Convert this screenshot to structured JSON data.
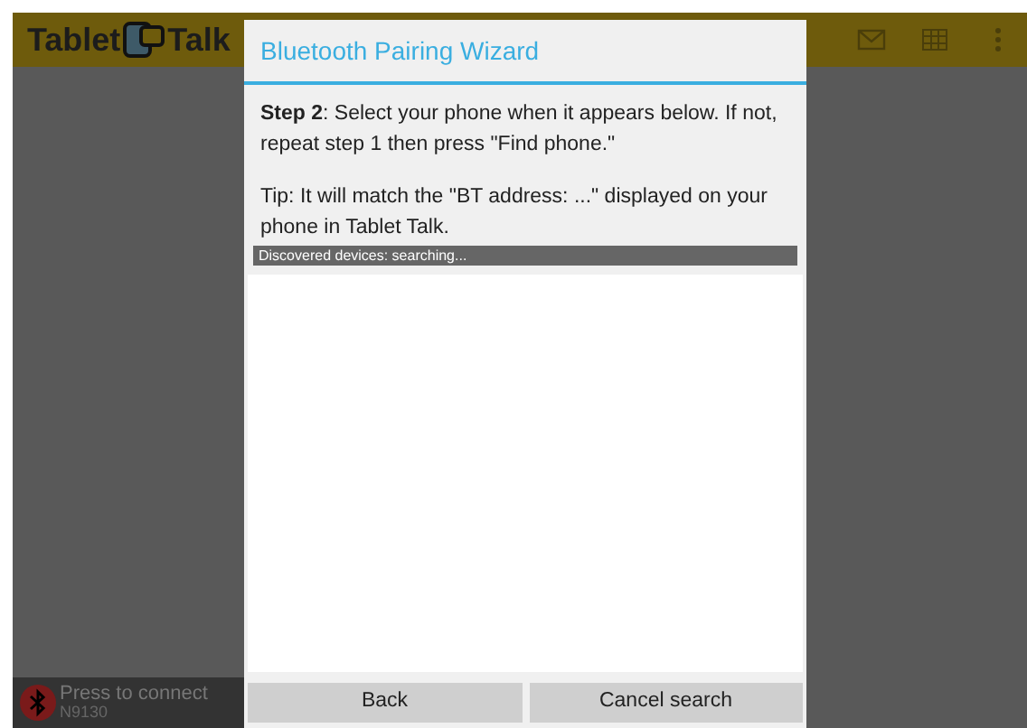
{
  "app_bar": {
    "logo_left": "Tablet",
    "logo_right": "Talk"
  },
  "dialog": {
    "title": "Bluetooth Pairing Wizard",
    "instructions": "**Step 2**: Select your phone when it appears below. If not, repeat step 1 then press \"Find phone.\"",
    "tip": "Tip: It will match the \"BT address: ...\" displayed on your phone in Tablet Talk.",
    "status": "Discovered devices: searching...",
    "buttons": [
      "Back",
      "Cancel search"
    ]
  },
  "connection": {
    "label": "Press to connect",
    "device": "N9130"
  }
}
